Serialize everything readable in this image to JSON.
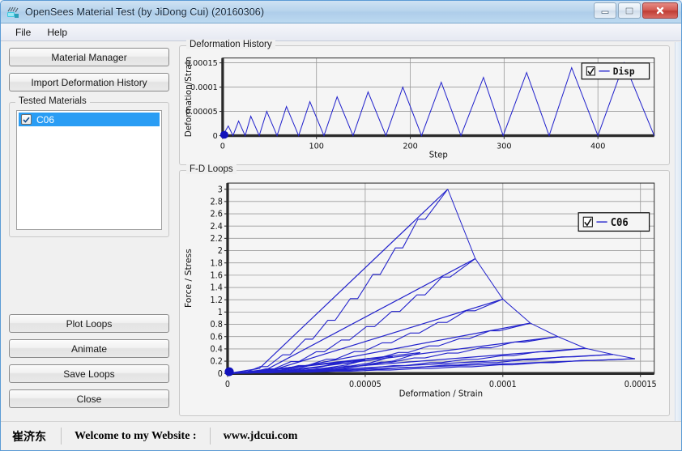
{
  "window": {
    "title": "OpenSees Material Test (by JiDong Cui) (20160306)",
    "icon": "opensees-app-icon",
    "controls": [
      {
        "name": "minimize-button",
        "glyph": "minimize"
      },
      {
        "name": "maximize-button",
        "glyph": "maximize"
      },
      {
        "name": "close-button",
        "glyph": "close"
      }
    ]
  },
  "menu": {
    "items": [
      "File",
      "Help"
    ]
  },
  "left_panel": {
    "material_manager_label": "Material Manager",
    "import_label": "Import Deformation History",
    "tested_materials_group": "Tested Materials",
    "materials": [
      {
        "label": "C06",
        "checked": true,
        "selected": true
      }
    ],
    "actions": [
      {
        "label": "Plot Loops",
        "name": "plot-loops-button"
      },
      {
        "label": "Animate",
        "name": "animate-button"
      },
      {
        "label": "Save Loops",
        "name": "save-loops-button"
      },
      {
        "label": "Close",
        "name": "close-button"
      }
    ]
  },
  "statusbar": {
    "author": "崔济东",
    "welcome": "Welcome to my Website :",
    "website": "www.jdcui.com"
  },
  "chart_data": [
    {
      "name": "deformation-history",
      "type": "line",
      "title": "Deformation History",
      "xlabel": "Step",
      "ylabel": "Deformation/Strain",
      "xlim": [
        0,
        460
      ],
      "ylim": [
        0,
        0.00016
      ],
      "xticks": [
        0,
        100,
        200,
        300,
        400
      ],
      "xticklabels": [
        "0",
        "100",
        "200",
        "300",
        "400"
      ],
      "yticks": [
        0,
        5e-05,
        0.0001,
        0.00015
      ],
      "yticklabels": [
        "0",
        "0.00005",
        "0.0001",
        "0.00015"
      ],
      "grid": true,
      "legend": {
        "position": "top-right",
        "entries": [
          {
            "label": "Disp",
            "checked": true,
            "color": "#2222cc"
          }
        ]
      },
      "series": [
        {
          "name": "Disp",
          "color": "#2222cc",
          "comment": "cyclic triangular ramp, amplitude grows 0.00002 -> 0.00015 in 0.00001 steps",
          "peaks": [
            2e-05,
            3e-05,
            4e-05,
            5e-05,
            6e-05,
            7e-05,
            8e-05,
            9e-05,
            0.0001,
            0.00011,
            0.00012,
            0.00013,
            0.00014,
            0.00015
          ],
          "peak_steps": [
            6,
            17,
            30,
            47,
            68,
            93,
            122,
            155,
            192,
            233,
            278,
            324,
            372,
            428
          ],
          "valley_steps": [
            0,
            11,
            24,
            39,
            58,
            81,
            108,
            139,
            174,
            212,
            254,
            299,
            348,
            400
          ],
          "end_step": 460,
          "end_value": 0.0
        }
      ],
      "markers": [
        {
          "x": 0,
          "y": 0,
          "color": "#1111bb",
          "size": 9
        }
      ]
    },
    {
      "name": "fd-loops",
      "type": "line",
      "title": "F-D Loops",
      "xlabel": "Deformation / Strain",
      "ylabel": "Force / Stress",
      "xlim": [
        0,
        0.000155
      ],
      "ylim": [
        0,
        3.1
      ],
      "xticks": [
        0,
        5e-05,
        0.0001,
        0.00015
      ],
      "xticklabels": [
        "0",
        "0.00005",
        "0.0001",
        "0.00015"
      ],
      "yticks": [
        0,
        0.2,
        0.4,
        0.6,
        0.8,
        1,
        1.2,
        1.4,
        1.6,
        1.8,
        2,
        2.2,
        2.4,
        2.6,
        2.8,
        3
      ],
      "yticklabels": [
        "0",
        "0.2",
        "0.4",
        "0.6",
        "0.8",
        "1",
        "1.2",
        "1.4",
        "1.6",
        "1.8",
        "2",
        "2.2",
        "2.4",
        "2.6",
        "2.8",
        "3"
      ],
      "grid": true,
      "legend": {
        "position": "top-right",
        "entries": [
          {
            "label": "C06",
            "checked": true,
            "color": "#2222cc"
          }
        ]
      },
      "envelope": {
        "comment": "descending backbone after peak force of 3.0",
        "points": [
          [
            8e-05,
            3.0
          ],
          [
            9e-05,
            1.87
          ],
          [
            0.0001,
            1.21
          ],
          [
            0.00011,
            0.82
          ],
          [
            0.00012,
            0.6
          ],
          [
            0.00013,
            0.41
          ],
          [
            0.00014,
            0.31
          ],
          [
            0.000148,
            0.24
          ]
        ]
      },
      "loading_branches": [
        {
          "peak": [
            8e-05,
            3.0
          ],
          "knee": [
            1.15e-05,
            0.08
          ]
        },
        {
          "peak": [
            9e-05,
            1.87
          ],
          "knee": [
            1.4e-05,
            0.06
          ]
        },
        {
          "peak": [
            0.0001,
            1.21
          ],
          "knee": [
            1.6e-05,
            0.05
          ]
        },
        {
          "peak": [
            0.00011,
            0.82
          ],
          "knee": [
            1.85e-05,
            0.045
          ]
        },
        {
          "peak": [
            0.00012,
            0.6
          ],
          "knee": [
            2.05e-05,
            0.04
          ]
        },
        {
          "peak": [
            0.00013,
            0.41
          ],
          "knee": [
            2.25e-05,
            0.035
          ]
        },
        {
          "peak": [
            0.00014,
            0.31
          ],
          "knee": [
            2.45e-05,
            0.03
          ]
        },
        {
          "peak": [
            0.000148,
            0.24
          ],
          "knee": [
            2.65e-05,
            0.028
          ]
        }
      ],
      "small_cycles": [
        {
          "peak": [
            2e-05,
            0.08
          ]
        },
        {
          "peak": [
            3e-05,
            0.13
          ]
        },
        {
          "peak": [
            4e-05,
            0.18
          ]
        },
        {
          "peak": [
            5e-05,
            0.22
          ]
        },
        {
          "peak": [
            6e-05,
            0.28
          ]
        },
        {
          "peak": [
            7e-05,
            0.34
          ]
        }
      ],
      "markers": [
        {
          "x": 0,
          "y": 0,
          "color": "#1111bb",
          "size": 9
        }
      ]
    }
  ],
  "colors": {
    "titlebar": "#b6d3ec",
    "selection": "#2a9df4",
    "plot_line": "#2222cc",
    "plot_bg": "#f5f5f5",
    "grid": "#9a9a9a",
    "close_button": "#bf3d35"
  }
}
